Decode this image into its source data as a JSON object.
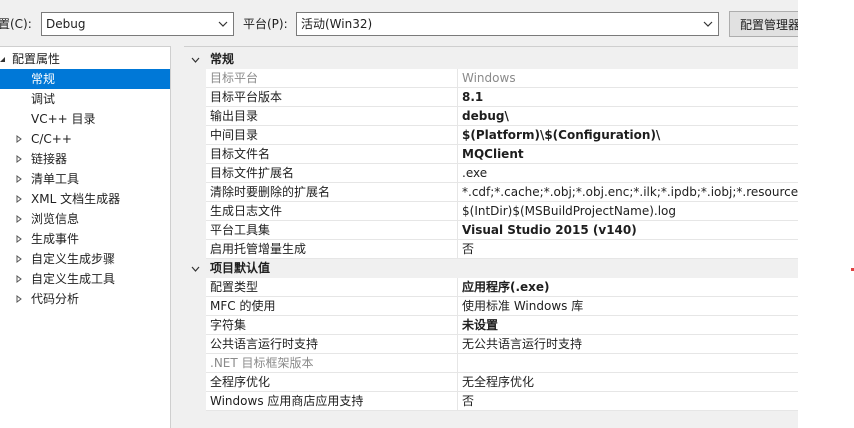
{
  "toolbar": {
    "config_label": "置(C):",
    "config_value": "Debug",
    "platform_label": "平台(P):",
    "platform_value": "活动(Win32)",
    "config_manager_label": "配置管理器"
  },
  "tree": {
    "root": "配置属性",
    "items": [
      {
        "label": "常规",
        "selected": true
      },
      {
        "label": "调试"
      },
      {
        "label": "VC++ 目录"
      },
      {
        "label": "C/C++"
      },
      {
        "label": "链接器"
      },
      {
        "label": "清单工具"
      },
      {
        "label": "XML 文档生成器"
      },
      {
        "label": "浏览信息"
      },
      {
        "label": "生成事件"
      },
      {
        "label": "自定义生成步骤"
      },
      {
        "label": "自定义生成工具"
      },
      {
        "label": "代码分析"
      }
    ]
  },
  "grid": {
    "sections": [
      {
        "title": "常规",
        "rows": [
          {
            "name": "目标平台",
            "value": "Windows",
            "disabled": true
          },
          {
            "name": "目标平台版本",
            "value": "8.1",
            "bold": true
          },
          {
            "name": "输出目录",
            "value": "debug\\",
            "bold": true
          },
          {
            "name": "中间目录",
            "value": "$(Platform)\\$(Configuration)\\",
            "bold": true
          },
          {
            "name": "目标文件名",
            "value": "MQClient",
            "bold": true
          },
          {
            "name": "目标文件扩展名",
            "value": ".exe"
          },
          {
            "name": "清除时要删除的扩展名",
            "value": "*.cdf;*.cache;*.obj;*.obj.enc;*.ilk;*.ipdb;*.iobj;*.resources;*.tlb;*.tli"
          },
          {
            "name": "生成日志文件",
            "value": "$(IntDir)$(MSBuildProjectName).log"
          },
          {
            "name": "平台工具集",
            "value": "Visual Studio 2015 (v140)",
            "bold": true
          },
          {
            "name": "启用托管增量生成",
            "value": "否"
          }
        ]
      },
      {
        "title": "项目默认值",
        "rows": [
          {
            "name": "配置类型",
            "value": "应用程序(.exe)",
            "bold": true
          },
          {
            "name": "MFC 的使用",
            "value": "使用标准 Windows 库"
          },
          {
            "name": "字符集",
            "value": "未设置",
            "bold": true
          },
          {
            "name": "公共语言运行时支持",
            "value": "无公共语言运行时支持"
          },
          {
            "name": ".NET 目标框架版本",
            "value": "",
            "disabled": true
          },
          {
            "name": "全程序优化",
            "value": "无全程序优化"
          },
          {
            "name": "Windows 应用商店应用支持",
            "value": "否"
          }
        ]
      }
    ]
  },
  "colors": {
    "selection": "#0078d7",
    "panel": "#f0f0f0",
    "disabled_text": "#8a8a8a"
  }
}
